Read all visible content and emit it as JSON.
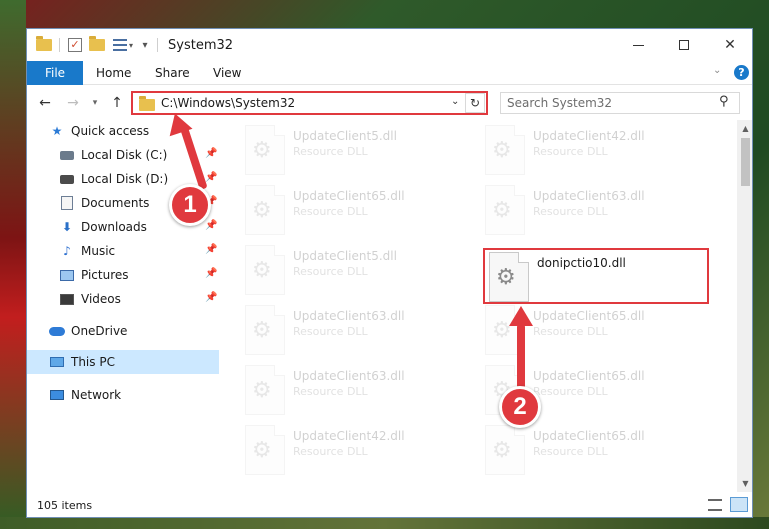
{
  "window": {
    "title": "System32"
  },
  "ribbon": {
    "tabs": [
      "File",
      "Home",
      "Share",
      "View"
    ],
    "help_label": "?"
  },
  "address": {
    "path": "C:\\Windows\\System32"
  },
  "search": {
    "placeholder": "Search System32"
  },
  "nav": {
    "items": [
      {
        "label": "Quick access",
        "icon": "star-icon"
      },
      {
        "label": "Local Disk (C:)",
        "icon": "drive-icon",
        "pinned": true
      },
      {
        "label": "Local Disk (D:)",
        "icon": "drive-icon",
        "pinned": true
      },
      {
        "label": "Documents",
        "icon": "documents-icon",
        "pinned": true
      },
      {
        "label": "Downloads",
        "icon": "downloads-icon",
        "pinned": true
      },
      {
        "label": "Music",
        "icon": "music-icon",
        "pinned": true
      },
      {
        "label": "Pictures",
        "icon": "pictures-icon",
        "pinned": true
      },
      {
        "label": "Videos",
        "icon": "videos-icon",
        "pinned": true
      },
      {
        "label": "OneDrive",
        "icon": "onedrive-icon"
      },
      {
        "label": "This PC",
        "icon": "this-pc-icon",
        "selected": true
      },
      {
        "label": "Network",
        "icon": "network-icon"
      }
    ]
  },
  "files": {
    "left": [
      {
        "name": "UpdateClient5.dll",
        "type": "Resource DLL"
      },
      {
        "name": "UpdateClient65.dll",
        "type": "Resource DLL"
      },
      {
        "name": "UpdateClient5.dll",
        "type": "Resource DLL"
      },
      {
        "name": "UpdateClient63.dll",
        "type": "Resource DLL"
      },
      {
        "name": "UpdateClient63.dll",
        "type": "Resource DLL"
      },
      {
        "name": "UpdateClient42.dll",
        "type": "Resource DLL"
      }
    ],
    "right": [
      {
        "name": "UpdateClient42.dll",
        "type": "Resource DLL"
      },
      {
        "name": "UpdateClient63.dll",
        "type": "Resource DLL"
      },
      {
        "name": "donipctio10.dll",
        "type": "",
        "highlighted": true
      },
      {
        "name": "UpdateClient65.dll",
        "type": "Resource DLL"
      },
      {
        "name": "UpdateClient65.dll",
        "type": "Resource DLL"
      },
      {
        "name": "UpdateClient65.dll",
        "type": "Resource DLL"
      }
    ]
  },
  "status": {
    "count": "105 items"
  },
  "annotations": {
    "badge1": "1",
    "badge2": "2"
  },
  "colors": {
    "accent": "#1979ca",
    "highlight": "#e0393e",
    "selected_bg": "#cce8ff"
  }
}
